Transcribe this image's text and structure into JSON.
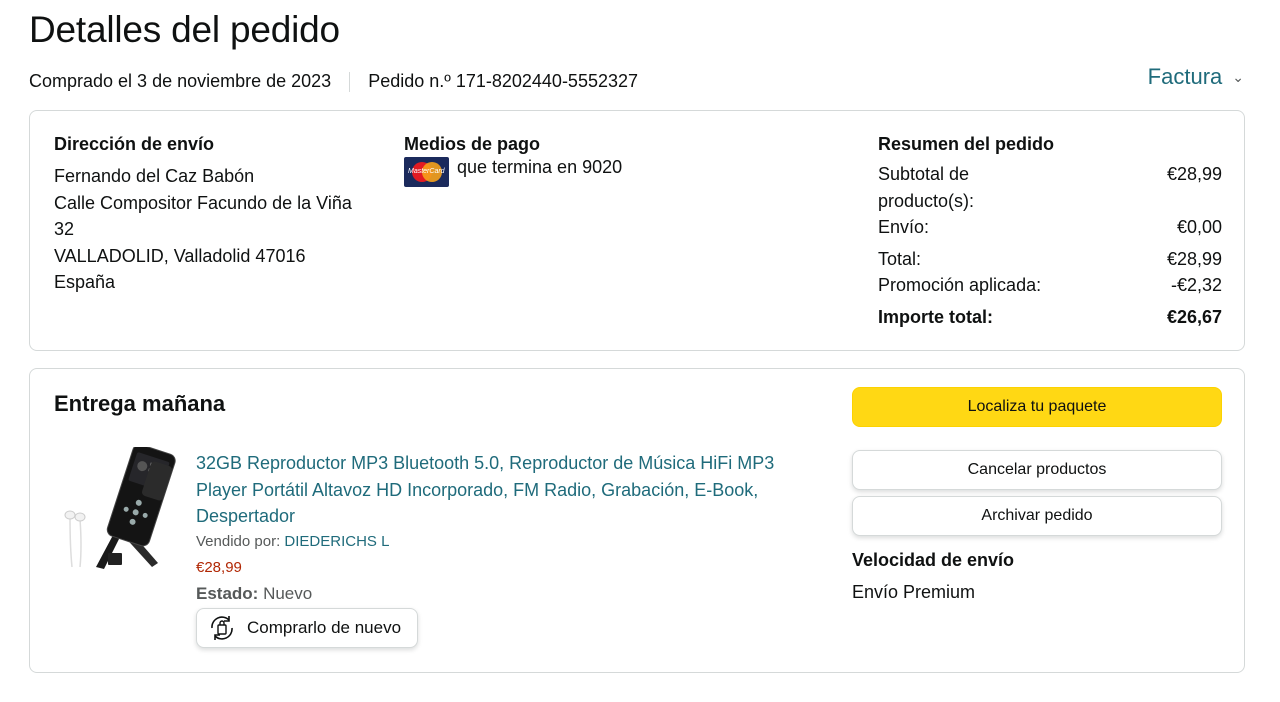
{
  "header": {
    "title": "Detalles del pedido",
    "purchased": "Comprado el 3 de noviembre de 2023",
    "order_number": "Pedido n.º 171-8202440-5552327",
    "invoice_label": "Factura"
  },
  "shipping_address": {
    "heading": "Dirección de envío",
    "lines": [
      "Fernando del Caz Babón",
      "Calle Compositor Facundo de la Viña",
      "32",
      "VALLADOLID, Valladolid 47016",
      "España"
    ]
  },
  "payment": {
    "heading": "Medios de pago",
    "card_brand": "MasterCard",
    "card_text": "que termina en 9020"
  },
  "summary": {
    "heading": "Resumen del pedido",
    "rows": [
      {
        "label": "Subtotal de producto(s):",
        "value": "€28,99"
      },
      {
        "label": "Envío:",
        "value": "€0,00"
      },
      {
        "label": "Total:",
        "value": "€28,99"
      },
      {
        "label": "Promoción aplicada:",
        "value": "-€2,32"
      },
      {
        "label": "Importe total:",
        "value": "€26,67"
      }
    ]
  },
  "delivery": {
    "heading": "Entrega mañana",
    "product_title": "32GB Reproductor MP3 Bluetooth 5.0, Reproductor de Música HiFi MP3 Player Portátil Altavoz HD Incorporado, FM Radio, Grabación, E-Book, Despertador",
    "seller_label": "Vendido por:",
    "seller_name": "DIEDERICHS L",
    "price": "€28,99",
    "condition_label": "Estado:",
    "condition_value": "Nuevo",
    "buy_again": "Comprarlo de nuevo"
  },
  "actions": {
    "track": "Localiza tu paquete",
    "cancel": "Cancelar productos",
    "archive": "Archivar pedido"
  },
  "shipping_speed": {
    "heading": "Velocidad de envío",
    "value": "Envío Premium"
  },
  "colors": {
    "link": "#1f6b7b",
    "price": "#b12704",
    "primary_button": "#ffd814",
    "border": "#d5d9d9"
  }
}
